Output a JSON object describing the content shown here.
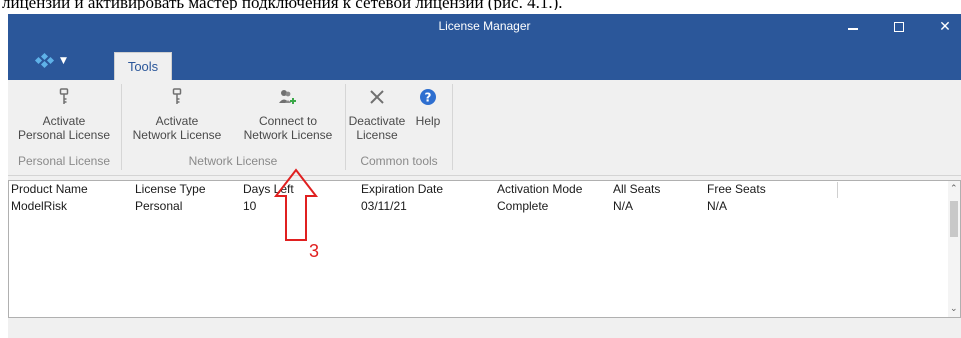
{
  "document": {
    "caption": "лицензии и активировать мастер подключения к сетевой лицензии (рис. 4.1.)."
  },
  "window": {
    "title": "License Manager"
  },
  "tabs": {
    "tools": "Tools"
  },
  "ribbon": {
    "activate_personal": [
      "Activate",
      "Personal License"
    ],
    "activate_network": [
      "Activate",
      "Network License"
    ],
    "connect_network": [
      "Connect to",
      "Network License"
    ],
    "deactivate": [
      "Deactivate",
      "License"
    ],
    "help": "Help",
    "groups": {
      "personal": "Personal License",
      "network": "Network License",
      "common": "Common tools"
    }
  },
  "table": {
    "columns": [
      "Product Name",
      "License Type",
      "Days Left",
      "Expiration Date",
      "Activation Mode",
      "All Seats",
      "Free Seats"
    ],
    "rows": [
      [
        "ModelRisk",
        "Personal",
        "10",
        "03/11/21",
        "Complete",
        "N/A",
        "N/A"
      ]
    ]
  },
  "annotation": {
    "label": "3",
    "color": "#e02020"
  },
  "colors": {
    "titlebar": "#2b579a",
    "accent": "#2b579a",
    "help_icon": "#2e6fd0",
    "connect_plus": "#3aa848"
  }
}
